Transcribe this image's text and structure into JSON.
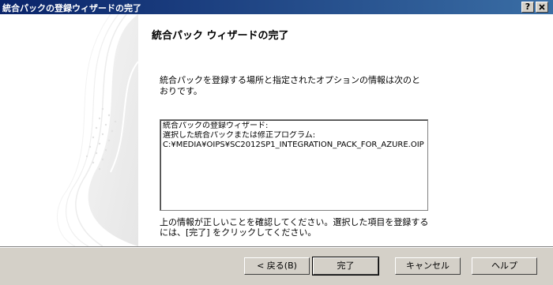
{
  "window": {
    "title": "統合パックの登録ウィザードの完了",
    "help_button": "?",
    "close_button": "X"
  },
  "content": {
    "heading": "統合パック ウィザードの完了",
    "description": "統合パックを登録する場所と指定されたオプションの情報は次のとおりです。",
    "summary": {
      "line1": "統合パックの登録ウィザード:",
      "line2": " 選択した統合パックまたは修正プログラム:",
      "line3": " C:¥MEDIA¥OIPS¥SC2012SP1_INTEGRATION_PACK_FOR_AZURE.OIP"
    },
    "confirm": "上の情報が正しいことを確認してください。選択した項目を登録するには、[完了] をクリックしてください。"
  },
  "footer": {
    "back": "< 戻る(B)",
    "finish": "完了",
    "cancel": "キャンセル",
    "help": "ヘルプ"
  }
}
